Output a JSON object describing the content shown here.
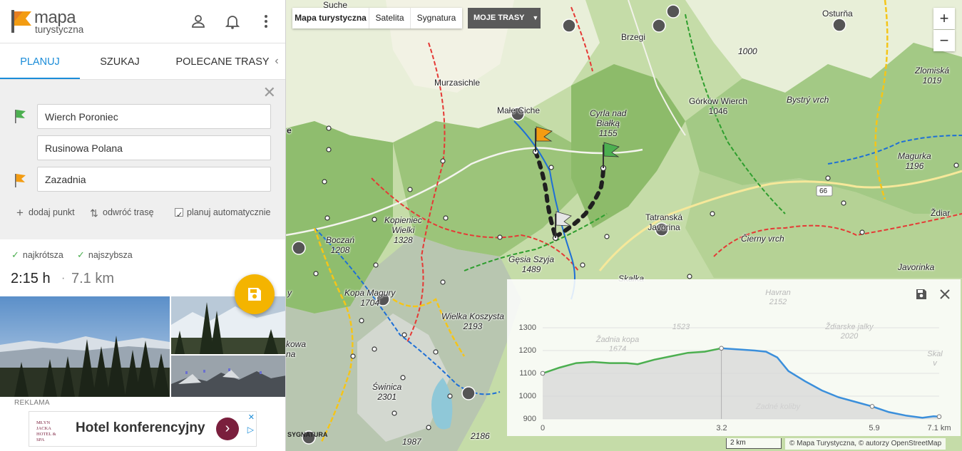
{
  "app": {
    "logo_line1": "mapa",
    "logo_line2": "turystyczna"
  },
  "topbar": {
    "icons": [
      "user-icon",
      "bell-icon",
      "more-vertical-icon"
    ]
  },
  "tabs": [
    {
      "label": "PLANUJ",
      "active": true
    },
    {
      "label": "SZUKAJ",
      "active": false
    },
    {
      "label": "POLECANE TRASY",
      "active": false
    }
  ],
  "planner": {
    "waypoints": [
      {
        "value": "Wierch Poroniec",
        "flag": "start",
        "flag_color": "#4caf50"
      },
      {
        "value": "Rusinowa Polana",
        "flag": "via",
        "flag_color": ""
      },
      {
        "value": "Zazadnia",
        "flag": "end",
        "flag_color": "#f39c12"
      }
    ],
    "add_point": "dodaj punkt",
    "reverse_route": "odwróć trasę",
    "auto_plan": "planuj automatycznie",
    "auto_plan_checked": true
  },
  "results": {
    "option_shortest": "najkrótsza",
    "option_fastest": "najszybsza",
    "duration": "2:15 h",
    "distance": "7.1 km"
  },
  "ad": {
    "label": "REKLAMA",
    "logo_text": "MŁYN JACKA HOTEL & SPA",
    "text": "Hotel konferencyjny"
  },
  "map_controls": {
    "types": [
      "Mapa turystyczna",
      "Satelita",
      "Sygnatura"
    ],
    "active_type": "Mapa turystyczna",
    "my_routes": "MOJE TRASY",
    "zoom_in": "+",
    "zoom_out": "−"
  },
  "map_labels": {
    "sucne": "Suche",
    "murzasichle": "Murzasichle",
    "male_ciche": "Małe Ciche",
    "cyrla": "Cyrla nad\nBiałką\n1155",
    "brzegi": "Brzegi",
    "osturna": "Osturňa",
    "v1000": "1000",
    "zlomiska": "Zlomiská\n1019",
    "gorkow": "Górków Wierch\n1046",
    "bystry": "Bystrý vrch",
    "magurka": "Magurka\n1196",
    "road66": "66",
    "zdiar": "Ždiar",
    "tatranska": "Tatranská\nJavorina",
    "cierny": "Čierny vrch",
    "javorinka": "Javorinka",
    "boczan": "Boczań\n1208",
    "kopieniec": "Kopieniec\nWielki\n1328",
    "gesia": "Gęsia Szyja\n1489",
    "kopa": "Kopa Magury\n1704",
    "wielka_koszysta": "Wielka Koszysta\n2193",
    "swinica": "Świnica\n2301",
    "v1987": "1987",
    "v2186": "2186",
    "skalka": "Skalka",
    "kowa": "kowa\nna",
    "e_edge": "e",
    "y_edge": "y"
  },
  "elevation": {
    "y_ticks": [
      "1300",
      "1200",
      "1100",
      "1000",
      "900"
    ],
    "x_ticks": [
      "0",
      "3.2",
      "5.9",
      "7.1 km"
    ],
    "profile": [
      [
        0,
        1100
      ],
      [
        0.3,
        1125
      ],
      [
        0.6,
        1145
      ],
      [
        0.9,
        1150
      ],
      [
        1.2,
        1145
      ],
      [
        1.5,
        1145
      ],
      [
        1.7,
        1140
      ],
      [
        2.0,
        1160
      ],
      [
        2.3,
        1175
      ],
      [
        2.6,
        1190
      ],
      [
        2.9,
        1195
      ],
      [
        3.2,
        1210
      ],
      [
        3.5,
        1205
      ],
      [
        3.8,
        1200
      ],
      [
        4.0,
        1195
      ],
      [
        4.2,
        1170
      ],
      [
        4.4,
        1110
      ],
      [
        4.7,
        1065
      ],
      [
        5.0,
        1025
      ],
      [
        5.3,
        995
      ],
      [
        5.6,
        975
      ],
      [
        5.9,
        955
      ],
      [
        6.2,
        930
      ],
      [
        6.5,
        915
      ],
      [
        6.8,
        905
      ],
      [
        7.0,
        912
      ],
      [
        7.1,
        910
      ]
    ],
    "line_color": "#4caf50",
    "line_color_descent": "#3b8fdb",
    "bg_labels": [
      "Havran\n2152",
      "1523",
      "Ždiarske jalky\n2020",
      "Žadnia kopa\n1674",
      "Skal\nv",
      "Zadné koliby"
    ]
  },
  "footer": {
    "scale": "2 km",
    "attribution": "© Mapa Turystyczna, © autorzy OpenStreetMap",
    "sygnatura": "SYGNATURA"
  },
  "colors": {
    "accent": "#1a8cd8",
    "fab": "#f4b400",
    "route": "#222222",
    "trail_red": "#e53935",
    "trail_blue": "#1e6fd6",
    "trail_green": "#2e9e2e",
    "trail_yellow": "#f5c518"
  }
}
